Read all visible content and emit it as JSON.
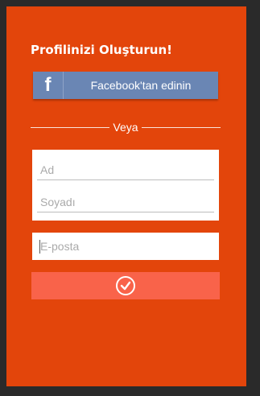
{
  "header": {
    "title": "Profilinizi Oluşturun!"
  },
  "facebook": {
    "icon_letter": "f",
    "icon": "facebook-icon",
    "label": "Facebook'tan edinin"
  },
  "divider": {
    "label": "Veya"
  },
  "form": {
    "first_name_placeholder": "Ad",
    "last_name_placeholder": "Soyadı",
    "email_placeholder": "E-posta",
    "submit_icon": "check-circle-icon"
  },
  "colors": {
    "background": "#e3450b",
    "facebook_button": "#6a86b4",
    "submit_button": "#f9634a",
    "field_background": "#ffffff"
  }
}
